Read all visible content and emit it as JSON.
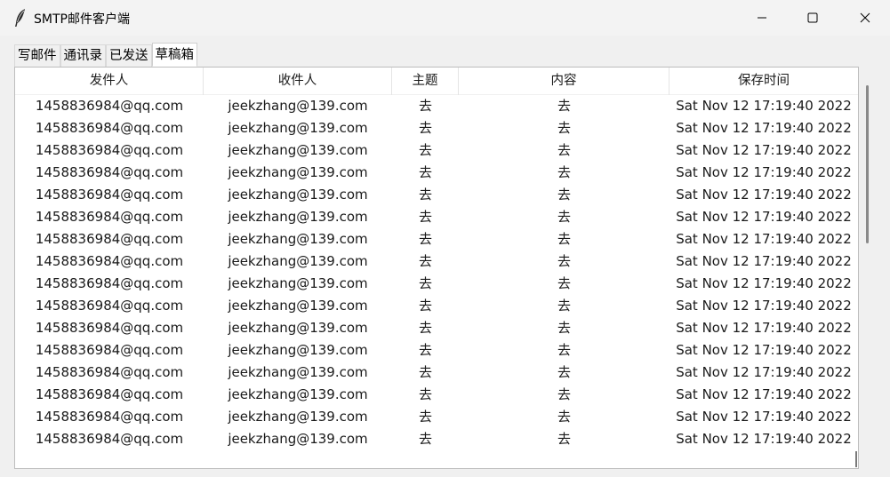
{
  "window": {
    "title": "SMTP邮件客户端",
    "app_icon": "feather-icon",
    "controls": {
      "minimize": "minimize-icon",
      "maximize": "maximize-icon",
      "close": "close-icon"
    }
  },
  "tabs": [
    {
      "label": "写邮件",
      "active": false
    },
    {
      "label": "通讯录",
      "active": false
    },
    {
      "label": "已发送",
      "active": false
    },
    {
      "label": "草稿箱",
      "active": true
    }
  ],
  "table": {
    "columns": [
      "发件人",
      "收件人",
      "主题",
      "内容",
      "保存时间"
    ],
    "rows": [
      [
        "1458836984@qq.com",
        "jeekzhang@139.com",
        "去",
        "去",
        "Sat Nov 12 17:19:40 2022"
      ],
      [
        "1458836984@qq.com",
        "jeekzhang@139.com",
        "去",
        "去",
        "Sat Nov 12 17:19:40 2022"
      ],
      [
        "1458836984@qq.com",
        "jeekzhang@139.com",
        "去",
        "去",
        "Sat Nov 12 17:19:40 2022"
      ],
      [
        "1458836984@qq.com",
        "jeekzhang@139.com",
        "去",
        "去",
        "Sat Nov 12 17:19:40 2022"
      ],
      [
        "1458836984@qq.com",
        "jeekzhang@139.com",
        "去",
        "去",
        "Sat Nov 12 17:19:40 2022"
      ],
      [
        "1458836984@qq.com",
        "jeekzhang@139.com",
        "去",
        "去",
        "Sat Nov 12 17:19:40 2022"
      ],
      [
        "1458836984@qq.com",
        "jeekzhang@139.com",
        "去",
        "去",
        "Sat Nov 12 17:19:40 2022"
      ],
      [
        "1458836984@qq.com",
        "jeekzhang@139.com",
        "去",
        "去",
        "Sat Nov 12 17:19:40 2022"
      ],
      [
        "1458836984@qq.com",
        "jeekzhang@139.com",
        "去",
        "去",
        "Sat Nov 12 17:19:40 2022"
      ],
      [
        "1458836984@qq.com",
        "jeekzhang@139.com",
        "去",
        "去",
        "Sat Nov 12 17:19:40 2022"
      ],
      [
        "1458836984@qq.com",
        "jeekzhang@139.com",
        "去",
        "去",
        "Sat Nov 12 17:19:40 2022"
      ],
      [
        "1458836984@qq.com",
        "jeekzhang@139.com",
        "去",
        "去",
        "Sat Nov 12 17:19:40 2022"
      ],
      [
        "1458836984@qq.com",
        "jeekzhang@139.com",
        "去",
        "去",
        "Sat Nov 12 17:19:40 2022"
      ],
      [
        "1458836984@qq.com",
        "jeekzhang@139.com",
        "去",
        "去",
        "Sat Nov 12 17:19:40 2022"
      ],
      [
        "1458836984@qq.com",
        "jeekzhang@139.com",
        "去",
        "去",
        "Sat Nov 12 17:19:40 2022"
      ],
      [
        "1458836984@qq.com",
        "jeekzhang@139.com",
        "去",
        "去",
        "Sat Nov 12 17:19:40 2022"
      ]
    ]
  },
  "colors": {
    "window_bg": "#f0f0f0",
    "panel_bg": "#ffffff",
    "text": "#1a1a1a",
    "scroll_thumb": "#8a8a8a"
  }
}
